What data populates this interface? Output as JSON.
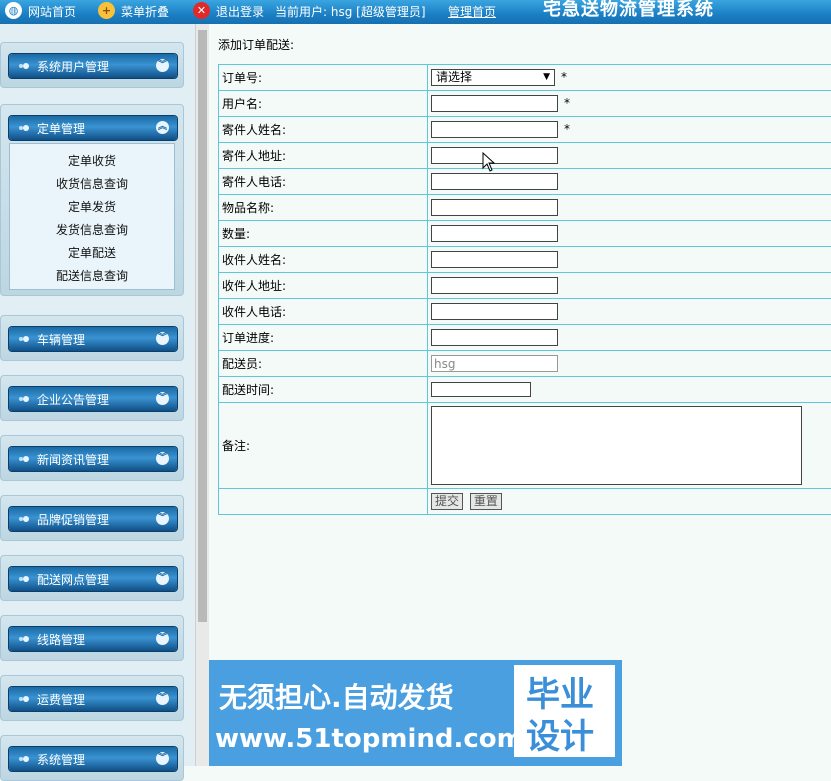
{
  "topbar": {
    "home_label": "网站首页",
    "collapse_label": "菜单折叠",
    "logout_label": "退出登录",
    "current_user_text": "当前用户: hsg [超级管理员]",
    "admin_home_label": "管理首页",
    "system_title": "宅急送物流管理系统",
    "colors": {
      "background": "#1b7fc4"
    },
    "icons": [
      "globe-icon",
      "collapse-icon",
      "logout-icon"
    ]
  },
  "sidebar": {
    "menus": [
      {
        "label": "系统用户管理"
      },
      {
        "label": "定单管理",
        "expanded": true
      },
      {
        "label": "车辆管理"
      },
      {
        "label": "企业公告管理"
      },
      {
        "label": "新闻资讯管理"
      },
      {
        "label": "品牌促销管理"
      },
      {
        "label": "配送网点管理"
      },
      {
        "label": "线路管理"
      },
      {
        "label": "运费管理"
      },
      {
        "label": "系统管理"
      }
    ],
    "submenu": [
      "定单收货",
      "收货信息查询",
      "定单发货",
      "发货信息查询",
      "定单配送",
      "配送信息查询"
    ]
  },
  "form": {
    "title": "添加订单配送:",
    "fields": [
      {
        "label": "订单号:",
        "select": "请选择",
        "required": true
      },
      {
        "label": "用户名:",
        "value": "",
        "required": true
      },
      {
        "label": "寄件人姓名:",
        "value": "",
        "required": true
      },
      {
        "label": "寄件人地址:",
        "value": ""
      },
      {
        "label": "寄件人电话:",
        "value": ""
      },
      {
        "label": "物品名称:",
        "value": ""
      },
      {
        "label": "数量:",
        "value": ""
      },
      {
        "label": "收件人姓名:",
        "value": ""
      },
      {
        "label": "收件人地址:",
        "value": ""
      },
      {
        "label": "收件人电话:",
        "value": ""
      },
      {
        "label": "订单进度:",
        "value": ""
      },
      {
        "label": "配送员:",
        "value": "hsg"
      },
      {
        "label": "配送时间:",
        "value": ""
      }
    ],
    "note_label": "备注:",
    "required_mark": "*",
    "submit_label": "提交",
    "reset_label": "重置",
    "border_color": "#5fc8d8"
  },
  "watermark": {
    "line1": "无须担心.自动发货",
    "line2": "www.51topmind.com",
    "badge_line1": "毕业",
    "badge_line2": "设计"
  }
}
